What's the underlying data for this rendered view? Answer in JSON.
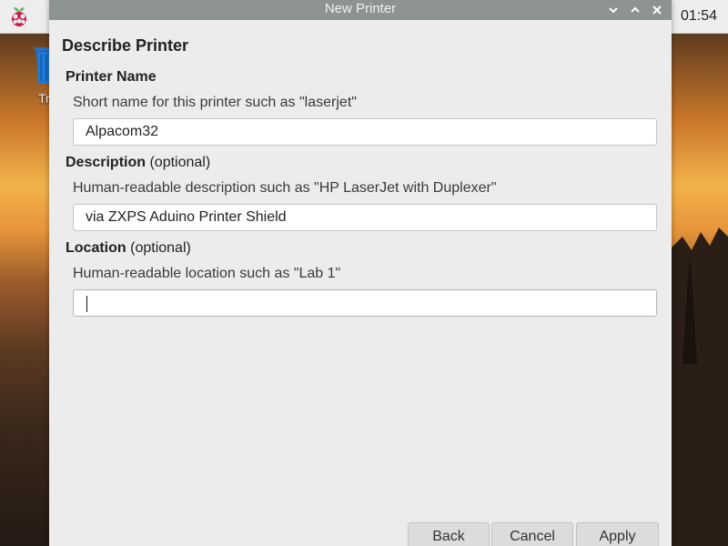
{
  "desktop": {
    "trash_label": "Tr",
    "clock": "01:54"
  },
  "window": {
    "title": "New Printer"
  },
  "dialog": {
    "heading": "Describe Printer",
    "printer_name": {
      "label": "Printer Name",
      "hint": "Short name for this printer such as \"laserjet\"",
      "value": "Alpacom32"
    },
    "description": {
      "label": "Description",
      "optional": "(optional)",
      "hint": "Human-readable description such as \"HP LaserJet with Duplexer\"",
      "value": "via ZXPS Aduino Printer Shield"
    },
    "location": {
      "label": "Location",
      "optional": "(optional)",
      "hint": "Human-readable location such as \"Lab 1\"",
      "value": ""
    }
  },
  "buttons": {
    "back": "Back",
    "cancel": "Cancel",
    "apply": "Apply"
  },
  "colors": {
    "titlebar": "#8d9293",
    "dialog_bg": "#ececec",
    "panel_bg": "#ededed"
  }
}
